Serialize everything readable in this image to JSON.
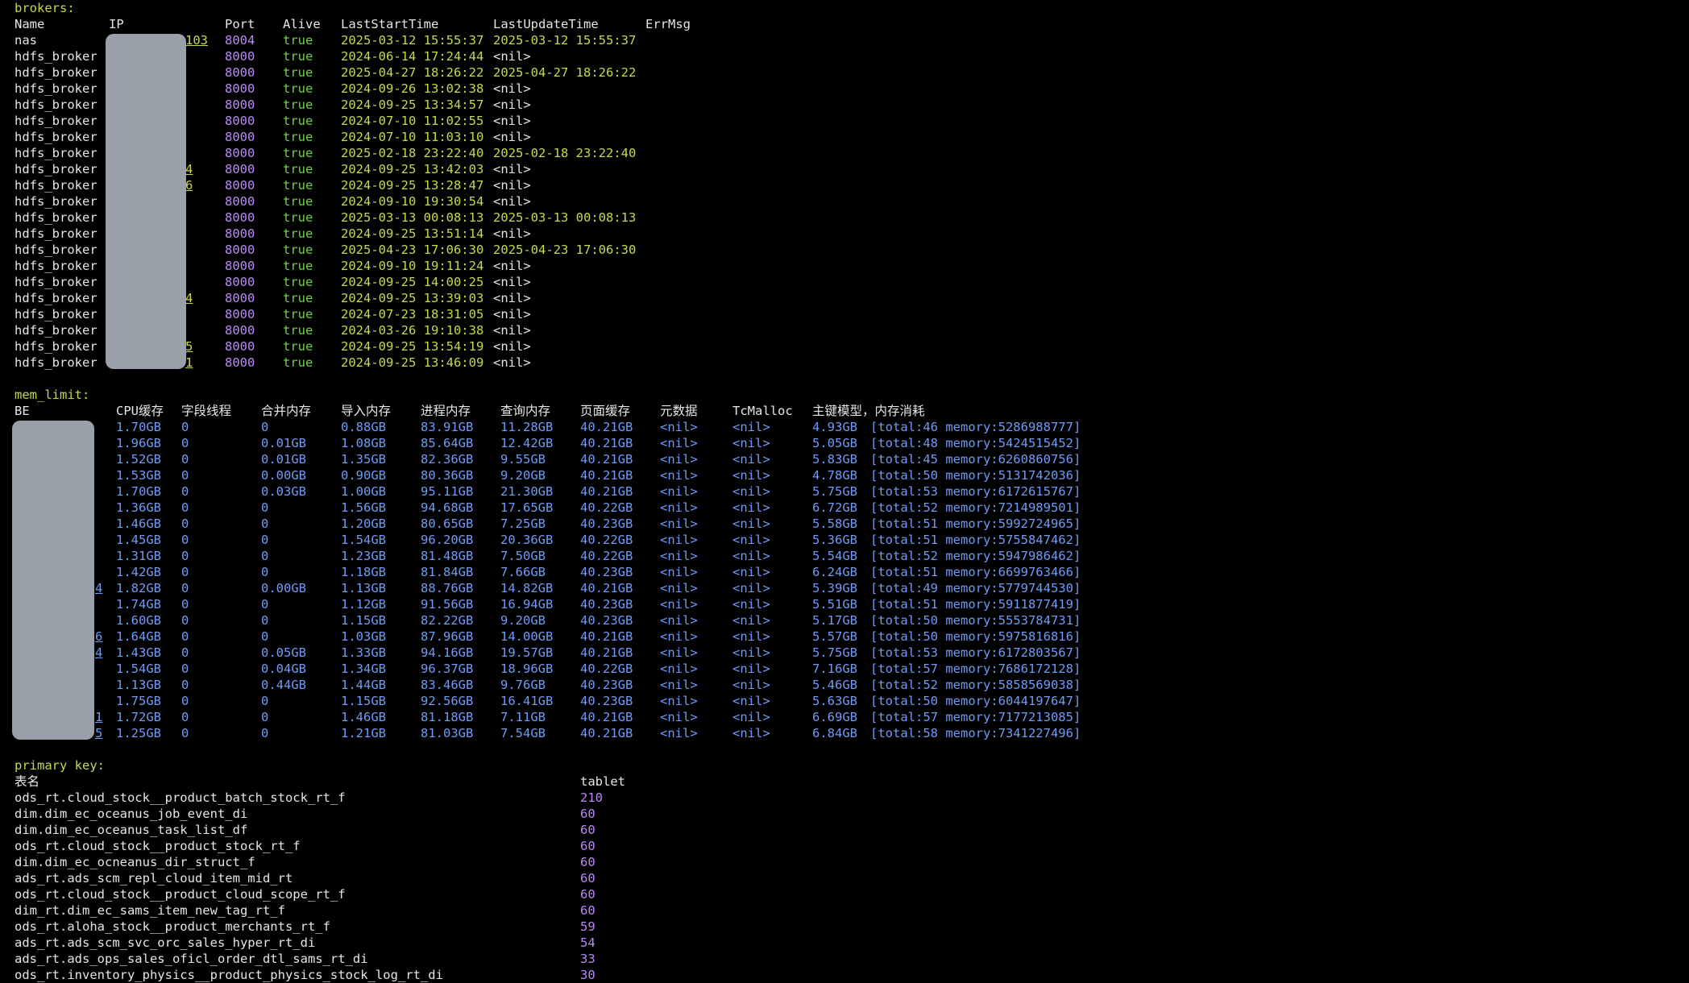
{
  "brokers": {
    "section_label": "brokers:",
    "headers": [
      "Name",
      "IP",
      "Port",
      "Alive",
      "LastStartTime",
      "LastUpdateTime",
      "ErrMsg"
    ],
    "rows": [
      {
        "name": "nas",
        "ip_visible": "103",
        "port": "8004",
        "alive": "true",
        "last_start": "2025-03-12 15:55:37",
        "last_update": "2025-03-12 15:55:37"
      },
      {
        "name": "hdfs_broker",
        "ip_visible": "",
        "port": "8000",
        "alive": "true",
        "last_start": "2024-06-14 17:24:44",
        "last_update": "<nil>"
      },
      {
        "name": "hdfs_broker",
        "ip_visible": "",
        "port": "8000",
        "alive": "true",
        "last_start": "2025-04-27 18:26:22",
        "last_update": "2025-04-27 18:26:22"
      },
      {
        "name": "hdfs_broker",
        "ip_visible": "",
        "port": "8000",
        "alive": "true",
        "last_start": "2024-09-26 13:02:38",
        "last_update": "<nil>"
      },
      {
        "name": "hdfs_broker",
        "ip_visible": "",
        "port": "8000",
        "alive": "true",
        "last_start": "2024-09-25 13:34:57",
        "last_update": "<nil>"
      },
      {
        "name": "hdfs_broker",
        "ip_visible": "",
        "port": "8000",
        "alive": "true",
        "last_start": "2024-07-10 11:02:55",
        "last_update": "<nil>"
      },
      {
        "name": "hdfs_broker",
        "ip_visible": "",
        "port": "8000",
        "alive": "true",
        "last_start": "2024-07-10 11:03:10",
        "last_update": "<nil>"
      },
      {
        "name": "hdfs_broker",
        "ip_visible": "",
        "port": "8000",
        "alive": "true",
        "last_start": "2025-02-18 23:22:40",
        "last_update": "2025-02-18 23:22:40"
      },
      {
        "name": "hdfs_broker",
        "ip_visible": "4",
        "port": "8000",
        "alive": "true",
        "last_start": "2024-09-25 13:42:03",
        "last_update": "<nil>"
      },
      {
        "name": "hdfs_broker",
        "ip_visible": "6",
        "port": "8000",
        "alive": "true",
        "last_start": "2024-09-25 13:28:47",
        "last_update": "<nil>"
      },
      {
        "name": "hdfs_broker",
        "ip_visible": "",
        "port": "8000",
        "alive": "true",
        "last_start": "2024-09-10 19:30:54",
        "last_update": "<nil>"
      },
      {
        "name": "hdfs_broker",
        "ip_visible": "",
        "port": "8000",
        "alive": "true",
        "last_start": "2025-03-13 00:08:13",
        "last_update": "2025-03-13 00:08:13"
      },
      {
        "name": "hdfs_broker",
        "ip_visible": "",
        "port": "8000",
        "alive": "true",
        "last_start": "2024-09-25 13:51:14",
        "last_update": "<nil>"
      },
      {
        "name": "hdfs_broker",
        "ip_visible": "",
        "port": "8000",
        "alive": "true",
        "last_start": "2025-04-23 17:06:30",
        "last_update": "2025-04-23 17:06:30"
      },
      {
        "name": "hdfs_broker",
        "ip_visible": "",
        "port": "8000",
        "alive": "true",
        "last_start": "2024-09-10 19:11:24",
        "last_update": "<nil>"
      },
      {
        "name": "hdfs_broker",
        "ip_visible": "",
        "port": "8000",
        "alive": "true",
        "last_start": "2024-09-25 14:00:25",
        "last_update": "<nil>"
      },
      {
        "name": "hdfs_broker",
        "ip_visible": "4",
        "port": "8000",
        "alive": "true",
        "last_start": "2024-09-25 13:39:03",
        "last_update": "<nil>"
      },
      {
        "name": "hdfs_broker",
        "ip_visible": "",
        "port": "8000",
        "alive": "true",
        "last_start": "2024-07-23 18:31:05",
        "last_update": "<nil>"
      },
      {
        "name": "hdfs_broker",
        "ip_visible": "",
        "port": "8000",
        "alive": "true",
        "last_start": "2024-03-26 19:10:38",
        "last_update": "<nil>"
      },
      {
        "name": "hdfs_broker",
        "ip_visible": "5",
        "port": "8000",
        "alive": "true",
        "last_start": "2024-09-25 13:54:19",
        "last_update": "<nil>"
      },
      {
        "name": "hdfs_broker",
        "ip_visible": "1",
        "port": "8000",
        "alive": "true",
        "last_start": "2024-09-25 13:46:09",
        "last_update": "<nil>"
      }
    ]
  },
  "mem_limit": {
    "section_label": "mem_limit:",
    "headers": [
      "BE",
      "CPU缓存",
      "字段线程",
      "合并内存",
      "导入内存",
      "进程内存",
      "查询内存",
      "页面缓存",
      "元数据",
      "TcMalloc",
      "主键模型，内存消耗"
    ],
    "rows": [
      {
        "be": "",
        "cpu": "1.70GB",
        "field": "0",
        "merge": "0",
        "load": "0.88GB",
        "proc": "83.91GB",
        "query": "11.28GB",
        "page": "40.21GB",
        "meta": "<nil>",
        "tcm": "<nil>",
        "pk": "4.93GB",
        "pk_detail": "[total:46 memory:5286988777]"
      },
      {
        "be": "",
        "cpu": "1.96GB",
        "field": "0",
        "merge": "0.01GB",
        "load": "1.08GB",
        "proc": "85.64GB",
        "query": "12.42GB",
        "page": "40.21GB",
        "meta": "<nil>",
        "tcm": "<nil>",
        "pk": "5.05GB",
        "pk_detail": "[total:48 memory:5424515452]"
      },
      {
        "be": "",
        "cpu": "1.52GB",
        "field": "0",
        "merge": "0.01GB",
        "load": "1.35GB",
        "proc": "82.36GB",
        "query": "9.55GB",
        "page": "40.21GB",
        "meta": "<nil>",
        "tcm": "<nil>",
        "pk": "5.83GB",
        "pk_detail": "[total:45 memory:6260860756]"
      },
      {
        "be": "",
        "cpu": "1.53GB",
        "field": "0",
        "merge": "0.00GB",
        "load": "0.90GB",
        "proc": "80.36GB",
        "query": "9.20GB",
        "page": "40.21GB",
        "meta": "<nil>",
        "tcm": "<nil>",
        "pk": "4.78GB",
        "pk_detail": "[total:50 memory:5131742036]"
      },
      {
        "be": "",
        "cpu": "1.70GB",
        "field": "0",
        "merge": "0.03GB",
        "load": "1.00GB",
        "proc": "95.11GB",
        "query": "21.30GB",
        "page": "40.21GB",
        "meta": "<nil>",
        "tcm": "<nil>",
        "pk": "5.75GB",
        "pk_detail": "[total:53 memory:6172615767]"
      },
      {
        "be": "",
        "cpu": "1.36GB",
        "field": "0",
        "merge": "0",
        "load": "1.56GB",
        "proc": "94.68GB",
        "query": "17.65GB",
        "page": "40.22GB",
        "meta": "<nil>",
        "tcm": "<nil>",
        "pk": "6.72GB",
        "pk_detail": "[total:52 memory:7214989501]"
      },
      {
        "be": "",
        "cpu": "1.46GB",
        "field": "0",
        "merge": "0",
        "load": "1.20GB",
        "proc": "80.65GB",
        "query": "7.25GB",
        "page": "40.23GB",
        "meta": "<nil>",
        "tcm": "<nil>",
        "pk": "5.58GB",
        "pk_detail": "[total:51 memory:5992724965]"
      },
      {
        "be": "",
        "cpu": "1.45GB",
        "field": "0",
        "merge": "0",
        "load": "1.54GB",
        "proc": "96.20GB",
        "query": "20.36GB",
        "page": "40.22GB",
        "meta": "<nil>",
        "tcm": "<nil>",
        "pk": "5.36GB",
        "pk_detail": "[total:51 memory:5755847462]"
      },
      {
        "be": "",
        "cpu": "1.31GB",
        "field": "0",
        "merge": "0",
        "load": "1.23GB",
        "proc": "81.48GB",
        "query": "7.50GB",
        "page": "40.22GB",
        "meta": "<nil>",
        "tcm": "<nil>",
        "pk": "5.54GB",
        "pk_detail": "[total:52 memory:5947986462]"
      },
      {
        "be": "",
        "cpu": "1.42GB",
        "field": "0",
        "merge": "0",
        "load": "1.18GB",
        "proc": "81.84GB",
        "query": "7.66GB",
        "page": "40.23GB",
        "meta": "<nil>",
        "tcm": "<nil>",
        "pk": "6.24GB",
        "pk_detail": "[total:51 memory:6699763466]"
      },
      {
        "be": "4",
        "cpu": "1.82GB",
        "field": "0",
        "merge": "0.00GB",
        "load": "1.13GB",
        "proc": "88.76GB",
        "query": "14.82GB",
        "page": "40.21GB",
        "meta": "<nil>",
        "tcm": "<nil>",
        "pk": "5.39GB",
        "pk_detail": "[total:49 memory:5779744530]"
      },
      {
        "be": "",
        "cpu": "1.74GB",
        "field": "0",
        "merge": "0",
        "load": "1.12GB",
        "proc": "91.56GB",
        "query": "16.94GB",
        "page": "40.23GB",
        "meta": "<nil>",
        "tcm": "<nil>",
        "pk": "5.51GB",
        "pk_detail": "[total:51 memory:5911877419]"
      },
      {
        "be": "",
        "cpu": "1.60GB",
        "field": "0",
        "merge": "0",
        "load": "1.15GB",
        "proc": "82.22GB",
        "query": "9.20GB",
        "page": "40.23GB",
        "meta": "<nil>",
        "tcm": "<nil>",
        "pk": "5.17GB",
        "pk_detail": "[total:50 memory:5553784731]"
      },
      {
        "be": "6",
        "cpu": "1.64GB",
        "field": "0",
        "merge": "0",
        "load": "1.03GB",
        "proc": "87.96GB",
        "query": "14.00GB",
        "page": "40.21GB",
        "meta": "<nil>",
        "tcm": "<nil>",
        "pk": "5.57GB",
        "pk_detail": "[total:50 memory:5975816816]"
      },
      {
        "be": "4",
        "cpu": "1.43GB",
        "field": "0",
        "merge": "0.05GB",
        "load": "1.33GB",
        "proc": "94.16GB",
        "query": "19.57GB",
        "page": "40.21GB",
        "meta": "<nil>",
        "tcm": "<nil>",
        "pk": "5.75GB",
        "pk_detail": "[total:53 memory:6172803567]"
      },
      {
        "be": "",
        "cpu": "1.54GB",
        "field": "0",
        "merge": "0.04GB",
        "load": "1.34GB",
        "proc": "96.37GB",
        "query": "18.96GB",
        "page": "40.22GB",
        "meta": "<nil>",
        "tcm": "<nil>",
        "pk": "7.16GB",
        "pk_detail": "[total:57 memory:7686172128]"
      },
      {
        "be": "",
        "cpu": "1.13GB",
        "field": "0",
        "merge": "0.44GB",
        "load": "1.44GB",
        "proc": "83.46GB",
        "query": "9.76GB",
        "page": "40.23GB",
        "meta": "<nil>",
        "tcm": "<nil>",
        "pk": "5.46GB",
        "pk_detail": "[total:52 memory:5858569038]"
      },
      {
        "be": "",
        "cpu": "1.75GB",
        "field": "0",
        "merge": "0",
        "load": "1.15GB",
        "proc": "92.56GB",
        "query": "16.41GB",
        "page": "40.23GB",
        "meta": "<nil>",
        "tcm": "<nil>",
        "pk": "5.63GB",
        "pk_detail": "[total:50 memory:6044197647]"
      },
      {
        "be": "1",
        "cpu": "1.72GB",
        "field": "0",
        "merge": "0",
        "load": "1.46GB",
        "proc": "81.18GB",
        "query": "7.11GB",
        "page": "40.21GB",
        "meta": "<nil>",
        "tcm": "<nil>",
        "pk": "6.69GB",
        "pk_detail": "[total:57 memory:7177213085]"
      },
      {
        "be": "5",
        "cpu": "1.25GB",
        "field": "0",
        "merge": "0",
        "load": "1.21GB",
        "proc": "81.03GB",
        "query": "7.54GB",
        "page": "40.21GB",
        "meta": "<nil>",
        "tcm": "<nil>",
        "pk": "6.84GB",
        "pk_detail": "[total:58 memory:7341227496]"
      }
    ]
  },
  "primary_key": {
    "section_label": "primary key:",
    "headers": [
      "表名",
      "tablet"
    ],
    "rows": [
      {
        "table": "ods_rt.cloud_stock__product_batch_stock_rt_f",
        "tablet": "210"
      },
      {
        "table": "dim.dim_ec_oceanus_job_event_di",
        "tablet": "60"
      },
      {
        "table": "dim.dim_ec_oceanus_task_list_df",
        "tablet": "60"
      },
      {
        "table": "ods_rt.cloud_stock__product_stock_rt_f",
        "tablet": "60"
      },
      {
        "table": "dim.dim_ec_ocneanus_dir_struct_f",
        "tablet": "60"
      },
      {
        "table": "ads_rt.ads_scm_repl_cloud_item_mid_rt",
        "tablet": "60"
      },
      {
        "table": "ods_rt.cloud_stock__product_cloud_scope_rt_f",
        "tablet": "60"
      },
      {
        "table": "dim_rt.dim_ec_sams_item_new_tag_rt_f",
        "tablet": "60"
      },
      {
        "table": "ods_rt.aloha_stock__product_merchants_rt_f",
        "tablet": "59"
      },
      {
        "table": "ads_rt.ads_scm_svc_orc_sales_hyper_rt_di",
        "tablet": "54"
      },
      {
        "table": "ads_rt.ads_ops_sales_oficl_order_dtl_sams_rt_di",
        "tablet": "33"
      },
      {
        "table": "ods_rt.inventory_physics__product_physics_stock_log_rt_di",
        "tablet": "30"
      }
    ]
  },
  "colors": {
    "background": "#000000",
    "section": "#c8d84a",
    "text": "#e6e6e6",
    "port": "#b98af3",
    "alive": "#6fd34a",
    "timestamp": "#c8d84a",
    "mem_value": "#6f9cf2",
    "tablet": "#b98af3",
    "redaction": "#9aa0a9"
  }
}
